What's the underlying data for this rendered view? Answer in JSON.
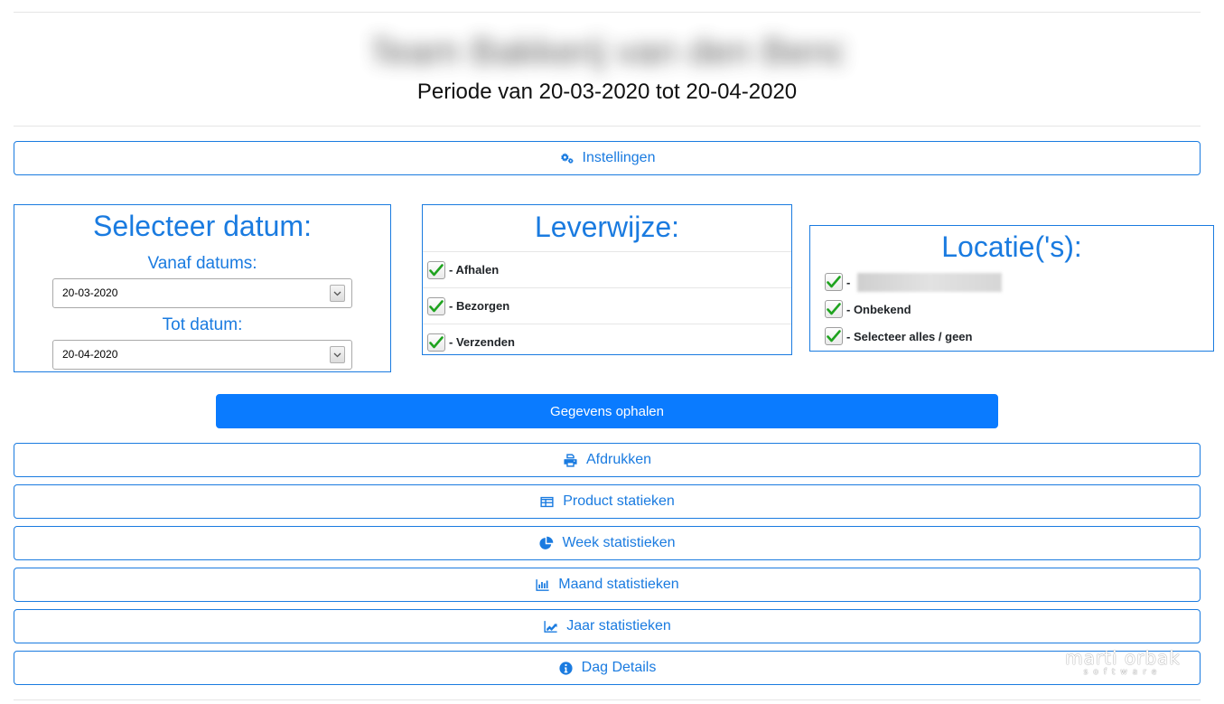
{
  "header": {
    "title_blurred": "Team Bakkerij van den Bend",
    "period": "Periode van 20-03-2020 tot 20-04-2020"
  },
  "settings_button": {
    "label": "Instellingen",
    "icon": "gears-icon"
  },
  "date_panel": {
    "title": "Selecteer datum:",
    "from_label": "Vanaf datums:",
    "from_value": "20-03-2020",
    "to_label": "Tot datum:",
    "to_value": "20-04-2020"
  },
  "delivery_panel": {
    "title": "Leverwijze:",
    "items": [
      {
        "label": "- Afhalen",
        "checked": true
      },
      {
        "label": "- Bezorgen",
        "checked": true
      },
      {
        "label": "- Verzenden",
        "checked": true
      }
    ]
  },
  "location_panel": {
    "title": "Locatie('s):",
    "items": [
      {
        "label": "- ",
        "checked": true,
        "value_hidden": true
      },
      {
        "label": "- Onbekend",
        "checked": true
      },
      {
        "label": "- Selecteer alles / geen",
        "checked": true
      }
    ]
  },
  "fetch_button": {
    "label": "Gegevens ophalen"
  },
  "actions": [
    {
      "label": "Afdrukken",
      "icon": "print-icon"
    },
    {
      "label": "Product statieken",
      "icon": "table-icon"
    },
    {
      "label": "Week statistieken",
      "icon": "pie-chart-icon"
    },
    {
      "label": "Maand statistieken",
      "icon": "bar-chart-icon"
    },
    {
      "label": "Jaar statistieken",
      "icon": "line-chart-icon"
    },
    {
      "label": "Dag Details",
      "icon": "info-circle-icon"
    }
  ],
  "watermark": {
    "line1": "marti orbak",
    "line2": "software"
  },
  "colors": {
    "accent": "#1a7be0",
    "primary": "#0a7bff",
    "check": "#1fa31f"
  }
}
